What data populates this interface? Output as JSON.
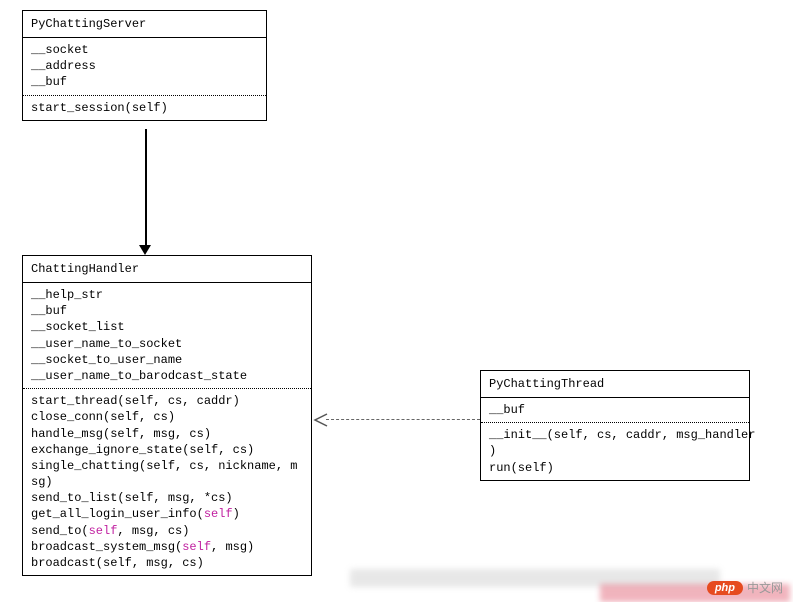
{
  "chart_data": {
    "type": "uml-class-diagram",
    "classes": [
      {
        "id": "PyChattingServer",
        "attributes": [
          "__socket",
          "__address",
          "__buf"
        ],
        "methods": [
          "start_session(self)"
        ]
      },
      {
        "id": "ChattingHandler",
        "attributes": [
          "__help_str",
          "__buf",
          "__socket_list",
          "__user_name_to_socket",
          "__socket_to_user_name",
          "__user_name_to_barodcast_state"
        ],
        "methods": [
          "start_thread(self, cs, caddr)",
          "close_conn(self, cs)",
          "handle_msg(self, msg, cs)",
          "exchange_ignore_state(self, cs)",
          "single_chatting(self, cs, nickname, msg)",
          "send_to_list(self, msg, *cs)",
          "get_all_login_user_info(self)",
          "send_to(self, msg, cs)",
          "broadcast_system_msg(self, msg)",
          "broadcast(self, msg, cs)"
        ]
      },
      {
        "id": "PyChattingThread",
        "attributes": [
          "__buf"
        ],
        "methods": [
          "__init__(self, cs, caddr, msg_handler)",
          "run(self)"
        ]
      }
    ],
    "relationships": [
      {
        "from": "PyChattingServer",
        "to": "ChattingHandler",
        "type": "association-arrow",
        "style": "solid"
      },
      {
        "from": "PyChattingThread",
        "to": "ChattingHandler",
        "type": "dependency-arrow",
        "style": "dashed"
      }
    ]
  },
  "server": {
    "title": "PyChattingServer",
    "a1": "__socket",
    "a2": "__address",
    "a3": "__buf",
    "m1": "start_session(self)"
  },
  "handler": {
    "title": "ChattingHandler",
    "a1": "__help_str",
    "a2": "__buf",
    "a3": "__socket_list",
    "a4": "__user_name_to_socket",
    "a5": "__socket_to_user_name",
    "a6": "__user_name_to_barodcast_state",
    "m1_a": "start_thread(self, cs, caddr)",
    "m2_a": "close_conn(self, cs)",
    "m3_a": "handle_msg(self, msg, cs)",
    "m4_a": "exchange_ignore_state(self, cs)",
    "m5_a": "single_chatting(self, cs, nickname, m",
    "m5_b": "sg)",
    "m6_a": "send_to_list(self, msg, *cs)",
    "m7_a": "get_all_login_user_info(",
    "m7_b": "self",
    "m7_c": ")",
    "m8_a": "send_to(",
    "m8_b": "self",
    "m8_c": ", msg, cs)",
    "m9_a": "broadcast_system_msg(",
    "m9_b": "self",
    "m9_c": ", msg)",
    "m10_a": "broadcast(self, msg, cs)"
  },
  "thread": {
    "title": "PyChattingThread",
    "a1": "__buf",
    "m1_a": "__init__(self, cs, caddr, msg_handler",
    "m1_b": ")",
    "m2": "run(self)"
  },
  "watermark": {
    "badge": "php",
    "text": "中文网"
  }
}
